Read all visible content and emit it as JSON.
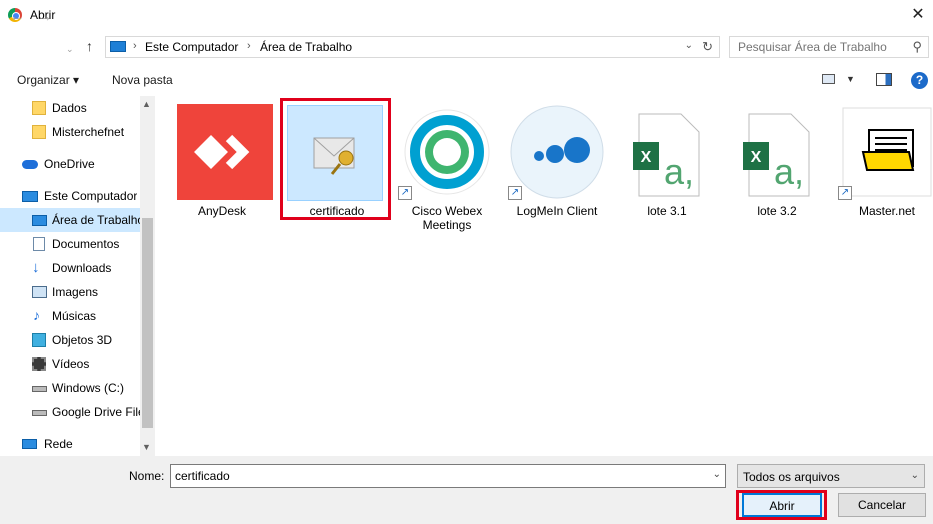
{
  "window": {
    "title": "Abrir"
  },
  "nav": {
    "breadcrumb": [
      "Este Computador",
      "Área de Trabalho"
    ],
    "search_placeholder": "Pesquisar Área de Trabalho"
  },
  "toolbar": {
    "organize": "Organizar ▾",
    "new_folder": "Nova pasta"
  },
  "sidebar": {
    "items": [
      {
        "label": "Dados",
        "icon": "folder-icon"
      },
      {
        "label": "Misterchefnet",
        "icon": "folder-icon"
      },
      {
        "label": "OneDrive",
        "icon": "cloud-icon"
      },
      {
        "label": "Este Computador",
        "icon": "computer-icon"
      },
      {
        "label": "Área de Trabalho",
        "icon": "desktop-icon",
        "selected": true
      },
      {
        "label": "Documentos",
        "icon": "documents-icon"
      },
      {
        "label": "Downloads",
        "icon": "download-icon"
      },
      {
        "label": "Imagens",
        "icon": "images-icon"
      },
      {
        "label": "Músicas",
        "icon": "music-icon"
      },
      {
        "label": "Objetos 3D",
        "icon": "cube-icon"
      },
      {
        "label": "Vídeos",
        "icon": "video-icon"
      },
      {
        "label": "Windows (C:)",
        "icon": "drive-icon"
      },
      {
        "label": "Google Drive File Stream",
        "icon": "drive-icon"
      },
      {
        "label": "Rede",
        "icon": "network-icon"
      }
    ]
  },
  "files": [
    {
      "name": "AnyDesk"
    },
    {
      "name": "certificado",
      "selected": true
    },
    {
      "name": "Cisco Webex Meetings"
    },
    {
      "name": "LogMeIn Client"
    },
    {
      "name": "lote 3.1"
    },
    {
      "name": "lote 3.2"
    },
    {
      "name": "Master.net"
    }
  ],
  "footer": {
    "name_label": "Nome:",
    "name_value": "certificado",
    "filter": "Todos os arquivos",
    "open": "Abrir",
    "cancel": "Cancelar"
  },
  "colors": {
    "accent": "#0078d7",
    "selection": "#cce8ff",
    "highlight": "#e0001b"
  }
}
